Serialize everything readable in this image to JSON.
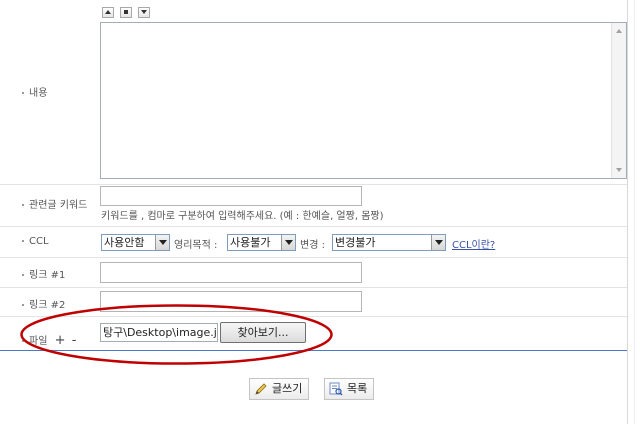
{
  "form": {
    "content_label": "내용",
    "keyword_label": "관련글 키워드",
    "keyword_hint": "키워드를 , 컴마로 구분하여 입력해주세요. (예 : 한예슬, 얼짱, 몸짱)",
    "ccl_label": "CCL",
    "ccl": {
      "usage_value": "사용안함",
      "commercial_label": "영리목적 :",
      "commercial_value": "사용불가",
      "modify_label": "변경 :",
      "modify_value": "변경불가",
      "ccl_link": "CCL이란?"
    },
    "link1_label": "링크 #1",
    "link2_label": "링크 #2",
    "file_label": "파일",
    "file_add": "+",
    "file_remove": "-",
    "file_path_value": "탕구\\Desktop\\image.jpg",
    "browse_label": "찾아보기..."
  },
  "actions": {
    "write_label": "글쓰기",
    "list_label": "목록"
  },
  "colors": {
    "annotation_ellipse": "#c00000",
    "divider_blue": "#4a78c2",
    "link": "#3a52a6"
  }
}
